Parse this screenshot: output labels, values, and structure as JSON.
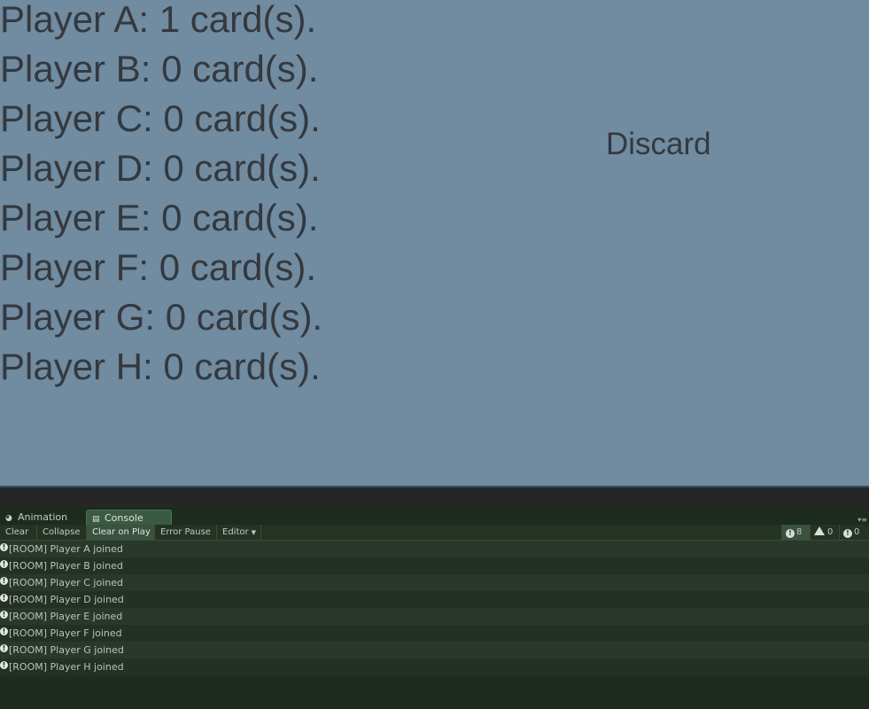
{
  "game": {
    "players": [
      "Player A: 1 card(s).",
      "Player B: 0 card(s).",
      "Player C: 0 card(s).",
      "Player D: 0 card(s).",
      "Player E: 0 card(s).",
      "Player F: 0 card(s).",
      "Player G: 0 card(s).",
      "Player H: 0 card(s)."
    ],
    "discard_label": "Discard",
    "colors": {
      "background": "#718ba0",
      "text": "#33393f"
    }
  },
  "tabs": [
    {
      "label": "Animation",
      "icon": "animation-icon",
      "active": false
    },
    {
      "label": "Console",
      "icon": "console-icon",
      "active": true
    }
  ],
  "toolbar": {
    "clear": "Clear",
    "collapse": "Collapse",
    "clear_on_play": "Clear on Play",
    "error_pause": "Error Pause",
    "editor": "Editor",
    "counts": {
      "log": "8",
      "warning": "0",
      "error": "0"
    }
  },
  "console": {
    "entries": [
      "[ROOM] Player A joined",
      "[ROOM] Player B joined",
      "[ROOM] Player C joined",
      "[ROOM] Player D joined",
      "[ROOM] Player E joined",
      "[ROOM] Player F joined",
      "[ROOM] Player G joined",
      "[ROOM] Player H joined"
    ],
    "entry_icon": "info-icon"
  }
}
